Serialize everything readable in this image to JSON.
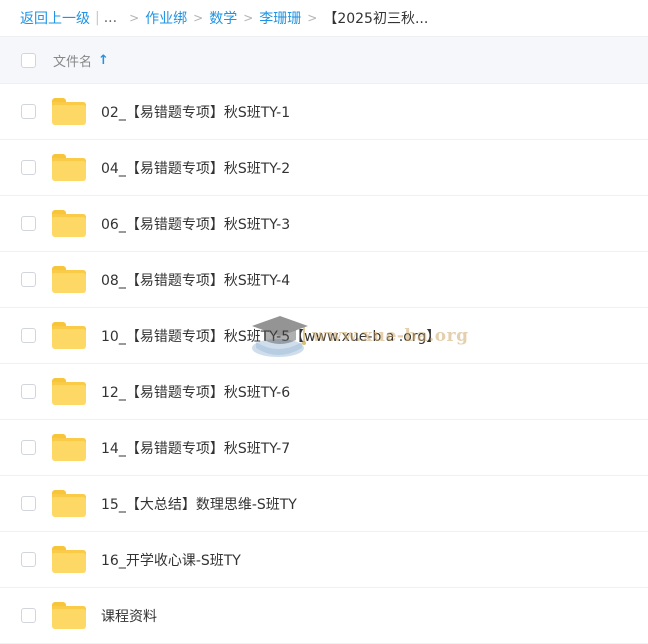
{
  "breadcrumb": {
    "back": "返回上一级",
    "bar": "|",
    "ellipsis": "...",
    "arrow": ">",
    "crumbs": [
      "作业绑",
      "数学",
      "李珊珊"
    ],
    "current": "【2025初三秋..."
  },
  "list_header": {
    "column_name": "文件名",
    "sort_icon": "arrow-up-icon",
    "sort_glyph": "↑"
  },
  "items": [
    {
      "name": "02_【易错题专项】秋S班TY-1",
      "icon": "folder-icon"
    },
    {
      "name": "04_【易错题专项】秋S班TY-2",
      "icon": "folder-icon"
    },
    {
      "name": "06_【易错题专项】秋S班TY-3",
      "icon": "folder-icon"
    },
    {
      "name": "08_【易错题专项】秋S班TY-4",
      "icon": "folder-icon"
    },
    {
      "name": "10_【易错题专项】秋S班TY-5【www.xue-b a .org】",
      "icon": "folder-icon"
    },
    {
      "name": "12_【易错题专项】秋S班TY-6",
      "icon": "folder-icon"
    },
    {
      "name": "14_【易错题专项】秋S班TY-7",
      "icon": "folder-icon"
    },
    {
      "name": "15_【大总结】数理思维-S班TY",
      "icon": "folder-icon"
    },
    {
      "name": "16_开学收心课-S班TY",
      "icon": "folder-icon"
    },
    {
      "name": "课程资料",
      "icon": "folder-icon"
    }
  ],
  "watermark": {
    "text": "www.xue-ba.org",
    "icon": "graduation-cap-icon"
  },
  "colors": {
    "link": "#1f94e3",
    "folder": "#fdd865",
    "header_bg": "#f5f7fb"
  }
}
